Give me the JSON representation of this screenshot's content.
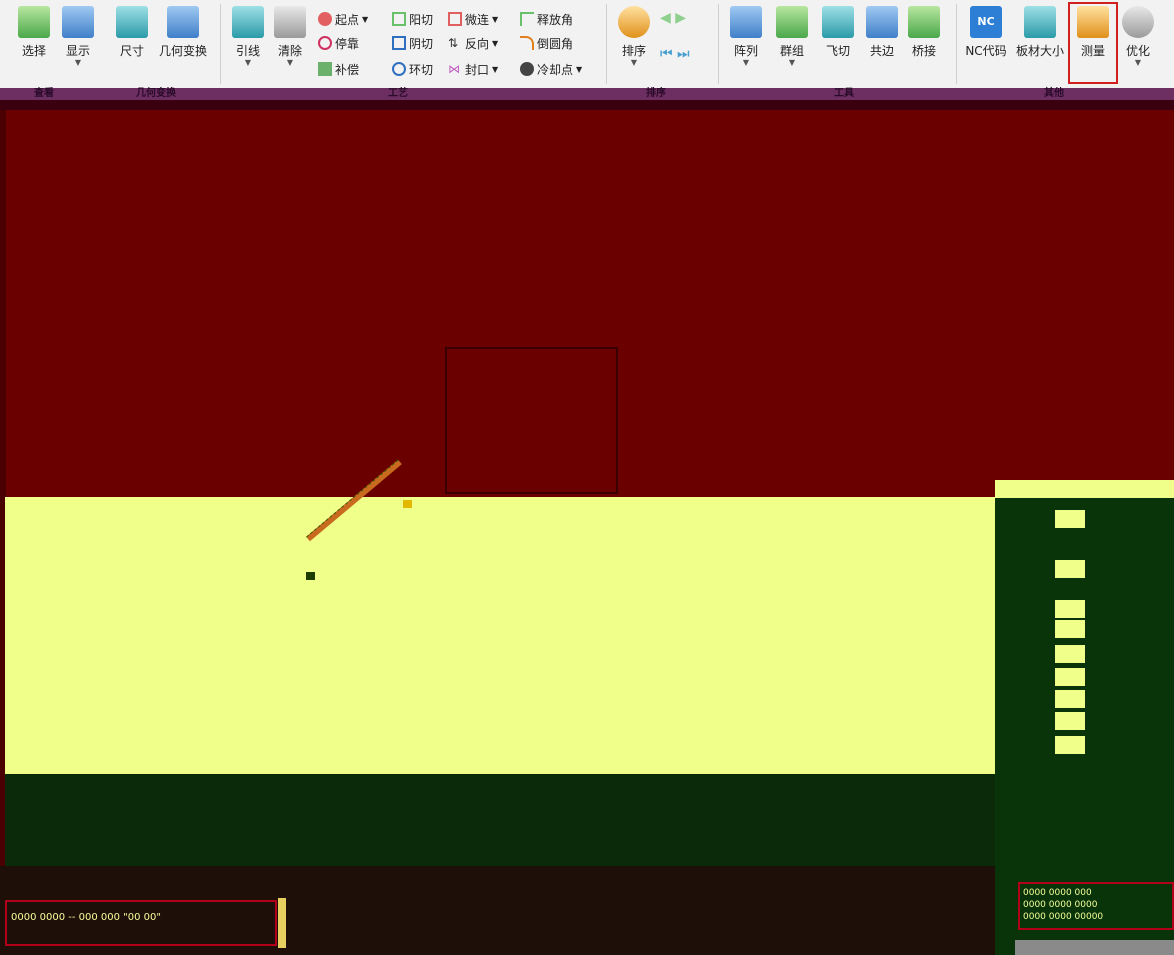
{
  "ribbon": {
    "tools": [
      {
        "name": "select",
        "label": "选择",
        "icon": "select-grid-icon"
      },
      {
        "name": "display",
        "label": "显示",
        "icon": "monitor-icon"
      },
      {
        "name": "size",
        "label": "尺寸",
        "icon": "size-icon"
      },
      {
        "name": "geometry",
        "label": "几何变换",
        "icon": "geometry-icon"
      },
      {
        "name": "leadline",
        "label": "引线",
        "icon": "leadline-icon"
      },
      {
        "name": "clear",
        "label": "清除",
        "icon": "trash-icon"
      }
    ],
    "small_buttons": [
      {
        "name": "start-point",
        "label": "起点"
      },
      {
        "name": "stop",
        "label": "停靠"
      },
      {
        "name": "compensate",
        "label": "补偿"
      },
      {
        "name": "outer-cut",
        "label": "阳切"
      },
      {
        "name": "inner-cut",
        "label": "阴切"
      },
      {
        "name": "ring-cut",
        "label": "环切"
      },
      {
        "name": "micro-joint",
        "label": "微连"
      },
      {
        "name": "reverse",
        "label": "反向"
      },
      {
        "name": "seal",
        "label": "封口"
      },
      {
        "name": "release-angle",
        "label": "释放角"
      },
      {
        "name": "round-corner",
        "label": "倒圆角"
      },
      {
        "name": "cooling-point",
        "label": "冷却点"
      }
    ],
    "tools_right": [
      {
        "name": "sort",
        "label": "排序",
        "icon": "sort-icon"
      },
      {
        "name": "array",
        "label": "阵列",
        "icon": "array-icon"
      },
      {
        "name": "group",
        "label": "群组",
        "icon": "group-icon"
      },
      {
        "name": "fly-cut",
        "label": "飞切",
        "icon": "fly-cut-icon"
      },
      {
        "name": "common-edge",
        "label": "共边",
        "icon": "common-edge-icon"
      },
      {
        "name": "bridge",
        "label": "桥接",
        "icon": "bridge-icon"
      },
      {
        "name": "nc-code",
        "label": "NC代码",
        "icon": "nc-icon"
      },
      {
        "name": "plate-size",
        "label": "板材大小",
        "icon": "plate-size-icon"
      },
      {
        "name": "measure",
        "label": "测量",
        "icon": "measure-icon"
      },
      {
        "name": "optimize",
        "label": "优化",
        "icon": "gauge-icon"
      }
    ],
    "nc_icon_text": "NC",
    "groups": [
      "查看",
      "几何变换",
      "工艺",
      "排序",
      "工具",
      "其他"
    ]
  },
  "status": {
    "text": "0000 0000 -- 000 000 \"00 00\""
  },
  "right_panel": {
    "rows": [
      "0000 0000 000",
      "0000 0000 0000",
      "0000 0000 00000"
    ]
  },
  "colors": {
    "canvas": "#6b0000",
    "plate": "#efff8a",
    "highlight": "#d02020"
  }
}
